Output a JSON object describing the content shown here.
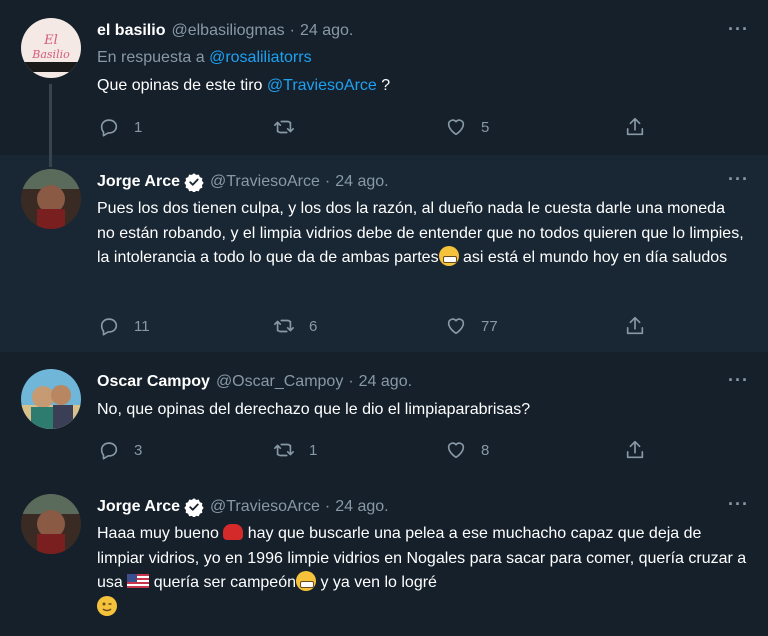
{
  "tweets": [
    {
      "name": "el basilio",
      "handle": "@elbasiliogmas",
      "date": "24 ago.",
      "verified": false,
      "reply_prefix": "En respuesta a",
      "reply_handle": "@rosaliliatorrs",
      "text_before": "Que opinas de este tiro ",
      "mention": "@TraviesoArce",
      "text_after": " ?",
      "replies": "1",
      "retweets": "",
      "likes": "5"
    },
    {
      "name": "Jorge Arce",
      "handle": "@TraviesoArce",
      "date": "24 ago.",
      "verified": true,
      "text_part1": "Pues los dos tienen culpa, y los dos la razón, al dueño nada le cuesta darle una moneda no están robando, y el limpia vidrios debe de entender que no todos quieren que lo limpies, la intolerancia a todo lo que da de ambas partes",
      "text_part2": " asi está el mundo hoy en día saludos",
      "replies": "11",
      "retweets": "6",
      "likes": "77"
    },
    {
      "name": "Oscar Campoy",
      "handle": "@Oscar_Campoy",
      "date": "24 ago.",
      "verified": false,
      "text": "No, que opinas del derechazo que le dio el limpiaparabrisas?",
      "replies": "3",
      "retweets": "1",
      "likes": "8"
    },
    {
      "name": "Jorge Arce",
      "handle": "@TraviesoArce",
      "date": "24 ago.",
      "verified": true,
      "text_part1": "Haaa muy bueno ",
      "text_part2": " hay que buscarle una pelea a ese muchacho capaz que deja de limpiar vidrios, yo en 1996 limpie vidrios en Nogales para sacar para comer, quería cruzar a usa ",
      "text_part3": " quería ser campeón",
      "text_part4": " y ya ven lo logré"
    }
  ],
  "dot_separator": "·",
  "more_label": "···",
  "colors": {
    "background": "#15202b",
    "highlight_background": "#192734",
    "link": "#1da1f2",
    "muted": "#8899a6",
    "verified": "#ffffff"
  },
  "icons": [
    "reply-icon",
    "retweet-icon",
    "like-icon",
    "share-icon",
    "verified-icon",
    "more-icon"
  ]
}
